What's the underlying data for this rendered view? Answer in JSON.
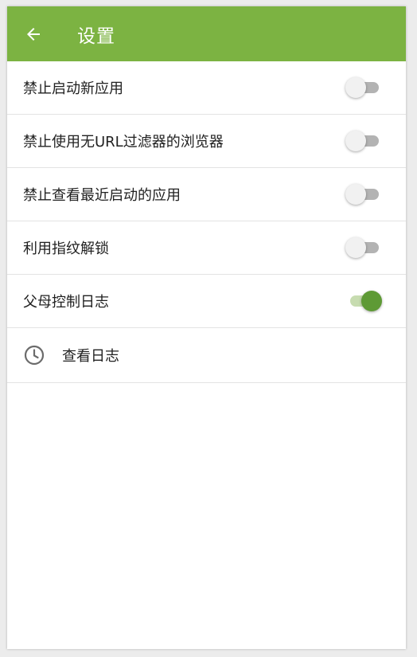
{
  "appbar": {
    "title": "设置",
    "back_icon": "arrow-back-icon",
    "background_color": "#7cb342"
  },
  "settings": [
    {
      "label": "禁止启动新应用",
      "enabled": false
    },
    {
      "label": "禁止使用无URL过滤器的浏览器",
      "enabled": false
    },
    {
      "label": "禁止查看最近启动的应用",
      "enabled": false
    },
    {
      "label": "利用指纹解锁",
      "enabled": false
    },
    {
      "label": "父母控制日志",
      "enabled": true
    }
  ],
  "view_log": {
    "label": "查看日志",
    "icon": "clock-icon"
  },
  "colors": {
    "switch_on": "#5e9a35",
    "switch_off": "#b3b3b3"
  }
}
